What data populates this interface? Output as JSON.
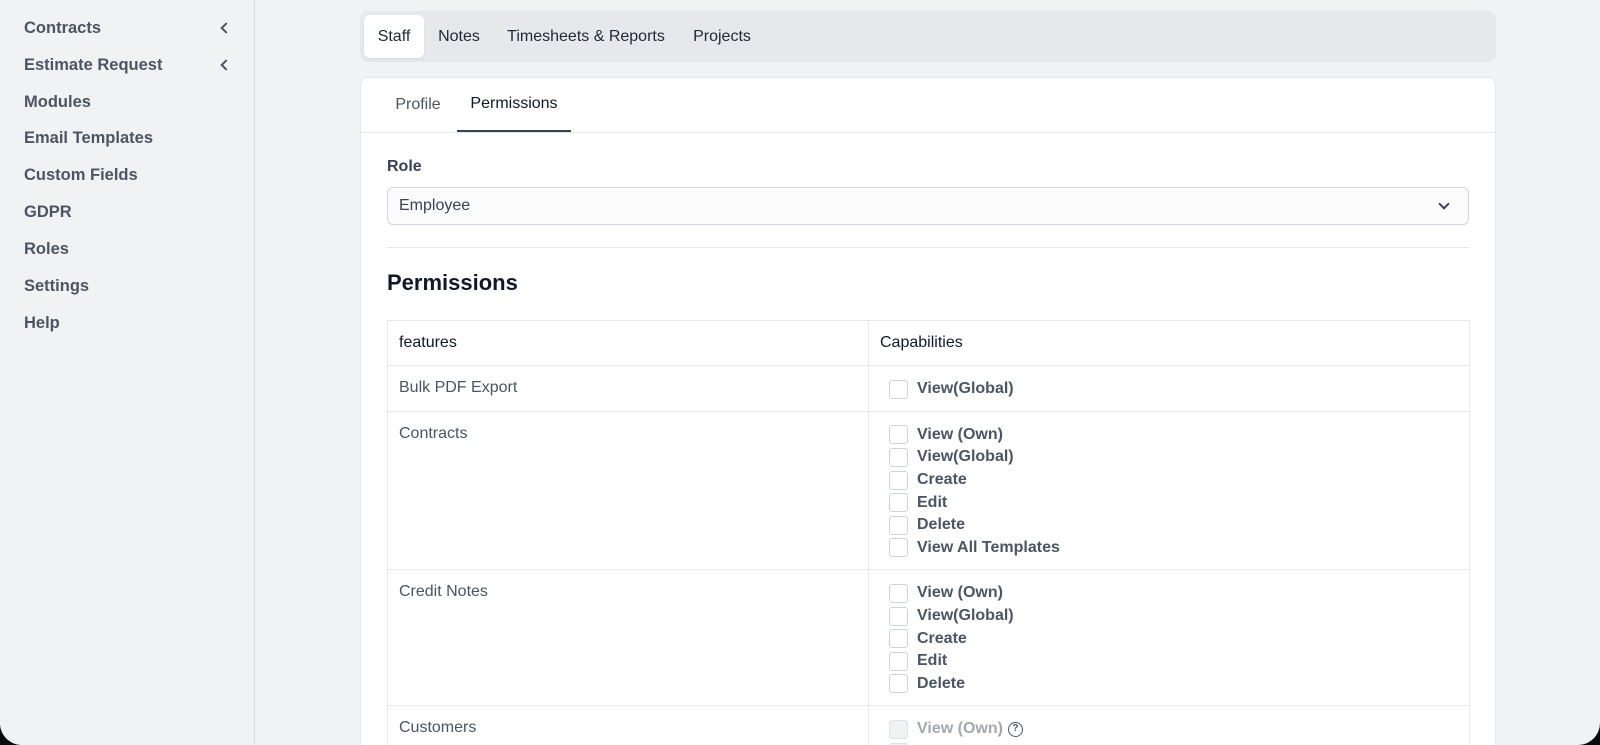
{
  "sidebar": {
    "items": [
      {
        "label": "Contracts",
        "expandable": true
      },
      {
        "label": "Estimate Request",
        "expandable": true
      },
      {
        "label": "Modules"
      },
      {
        "label": "Email Templates"
      },
      {
        "label": "Custom Fields"
      },
      {
        "label": "GDPR"
      },
      {
        "label": "Roles"
      },
      {
        "label": "Settings"
      },
      {
        "label": "Help"
      }
    ]
  },
  "top_tabs": {
    "items": [
      "Staff",
      "Notes",
      "Timesheets & Reports",
      "Projects"
    ],
    "active": "Staff"
  },
  "sub_tabs": {
    "items": [
      "Profile",
      "Permissions"
    ],
    "active": "Permissions"
  },
  "role": {
    "label": "Role",
    "value": "Employee"
  },
  "permissions": {
    "heading": "Permissions",
    "col_features": "features",
    "col_capabilities": "Capabilities",
    "rows": [
      {
        "feature": "Bulk PDF Export",
        "capabilities": [
          {
            "label": "View(Global)",
            "checked": false
          }
        ]
      },
      {
        "feature": "Contracts",
        "capabilities": [
          {
            "label": "View (Own)",
            "checked": false
          },
          {
            "label": "View(Global)",
            "checked": false
          },
          {
            "label": "Create",
            "checked": false
          },
          {
            "label": "Edit",
            "checked": false
          },
          {
            "label": "Delete",
            "checked": false
          },
          {
            "label": "View All Templates",
            "checked": false
          }
        ]
      },
      {
        "feature": "Credit Notes",
        "capabilities": [
          {
            "label": "View (Own)",
            "checked": false
          },
          {
            "label": "View(Global)",
            "checked": false
          },
          {
            "label": "Create",
            "checked": false
          },
          {
            "label": "Edit",
            "checked": false
          },
          {
            "label": "Delete",
            "checked": false
          }
        ]
      },
      {
        "feature": "Customers",
        "capabilities": [
          {
            "label": "View (Own)",
            "checked": false,
            "disabled": true,
            "help": true
          }
        ]
      }
    ]
  },
  "icons": {
    "help": "question-circle-icon",
    "expand": "chevron-left-icon",
    "dropdown": "chevron-down-icon"
  }
}
